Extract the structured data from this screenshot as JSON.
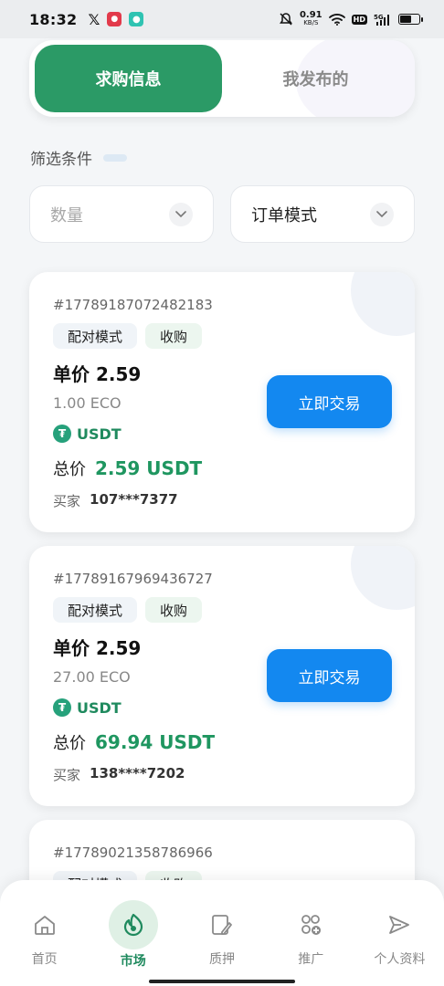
{
  "status_bar": {
    "time": "18:32",
    "speed_value": "0.91",
    "speed_unit": "KB/S",
    "hd": "HD",
    "network": "5G"
  },
  "tabs": [
    {
      "label": "求购信息",
      "active": true
    },
    {
      "label": "我发布的",
      "active": false
    }
  ],
  "filter": {
    "title": "筛选条件",
    "quantity_placeholder": "数量",
    "mode_label": "订单模式"
  },
  "orders": [
    {
      "id": "#17789187072482183",
      "mode_tag": "配对模式",
      "type_tag": "收购",
      "unit_price": "单价 2.59",
      "quantity": "1.00 ECO",
      "coin": "USDT",
      "total_label": "总价",
      "total_value": "2.59 USDT",
      "buyer_label": "买家",
      "buyer_id": "107***7377",
      "button": "立即交易"
    },
    {
      "id": "#17789167969436727",
      "mode_tag": "配对模式",
      "type_tag": "收购",
      "unit_price": "单价 2.59",
      "quantity": "27.00 ECO",
      "coin": "USDT",
      "total_label": "总价",
      "total_value": "69.94 USDT",
      "buyer_label": "买家",
      "buyer_id": "138****7202",
      "button": "立即交易"
    },
    {
      "id": "#17789021358786966",
      "mode_tag": "配对模式",
      "type_tag": "收购"
    }
  ],
  "bottom_nav": [
    {
      "label": "首页",
      "icon": "home-icon",
      "active": false
    },
    {
      "label": "市场",
      "icon": "market-icon",
      "active": true
    },
    {
      "label": "质押",
      "icon": "pledge-icon",
      "active": false
    },
    {
      "label": "推广",
      "icon": "promote-icon",
      "active": false
    },
    {
      "label": "个人资料",
      "icon": "send-icon",
      "active": false
    }
  ],
  "colors": {
    "accent_green": "#2b9a66",
    "button_blue": "#1388f0",
    "usdt_green": "#26a17b"
  }
}
